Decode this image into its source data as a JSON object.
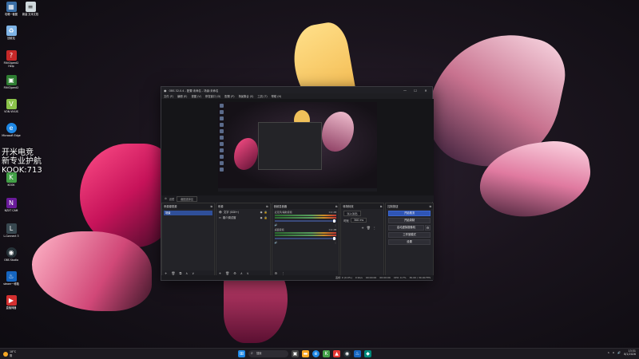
{
  "desktop": {
    "icons": [
      {
        "label": "攻略一截图",
        "icon": "image-file-icon",
        "color": "#3a6ea5"
      },
      {
        "label": "新建 文本文档",
        "icon": "text-file-icon",
        "color": "#cfd8dc"
      },
      {
        "label": "回收站",
        "icon": "recycle-bin-icon",
        "color": "#7fb4e6"
      },
      {
        "label": "FlitIO/pent2 Help",
        "icon": "help-file-icon",
        "color": "#c62828"
      },
      {
        "label": "FlitIO/pent2",
        "icon": "app-icon",
        "color": "#2e7d32"
      },
      {
        "label": "VON VIVUS",
        "icon": "v-app-icon",
        "color": "#8bc34a"
      },
      {
        "label": "Microsoft Edge",
        "icon": "edge-icon",
        "color": "#1e88e5"
      },
      {
        "label": "KOOK",
        "icon": "kook-icon",
        "color": "#43a047"
      },
      {
        "label": "NZXT CAM",
        "icon": "nzxt-cam-icon",
        "color": "#6a1b9a"
      },
      {
        "label": "L-Connect 3",
        "icon": "l-connect-icon",
        "color": "#37474f"
      },
      {
        "label": "OBS Studio",
        "icon": "obs-icon",
        "color": "#263238"
      },
      {
        "label": "steam一堆箱",
        "icon": "steam-icon",
        "color": "#1565c0"
      },
      {
        "label": "直播神器",
        "icon": "live-icon",
        "color": "#d32f2f"
      }
    ],
    "overlay_lines": [
      "开米电竞",
      "新专业护航",
      "KOOK:713"
    ]
  },
  "obs": {
    "title": "OBS 32.0.4 - 配置:未命名 - 场景:未命名",
    "window_controls": [
      "—",
      "☐",
      "✕"
    ],
    "menu": [
      "文件 (F)",
      "编辑 (E)",
      "视图 (V)",
      "停靠窗口 (D)",
      "配置 (P)",
      "场景集合 (S)",
      "工具 (T)",
      "帮助 (H)"
    ],
    "source_toolbar": {
      "gear": "⚙",
      "filter": "滤镜",
      "dropdown": "截图选择区"
    },
    "docks": {
      "scenes": {
        "title": "来源源类源",
        "items": [
          "场景"
        ]
      },
      "sources": {
        "title": "来源",
        "items": [
          {
            "name": "文字 (GDI+)"
          },
          {
            "name": "媒介调试窗"
          }
        ]
      },
      "mixer": {
        "title": "音频混音器",
        "channels": [
          {
            "name": "麦克风/辅助音频",
            "db": "0.0 dB",
            "level": 0.8
          },
          {
            "name": "桌面音频",
            "db": "0.0 dB",
            "level": 0.85
          }
        ]
      },
      "transitions": {
        "title": "转场特效",
        "type": "淡入淡出",
        "duration_label": "时长",
        "duration": "300 ms"
      },
      "controls": {
        "title": "控制按钮",
        "start_stream": "开始推流",
        "start_record": "开始录制",
        "virtual_cam": "启动虚拟摄像机",
        "studio_mode": "工作室模式",
        "settings": "设置"
      }
    },
    "dock_footer_icons": [
      "+",
      "🗑",
      "⧉",
      "∧",
      "∨"
    ],
    "status": {
      "frames": "丢帧: 0 (0.0%)",
      "bitrate": "0 kb/s",
      "rec_time": "00:00:00",
      "stream_time": "00:00:00",
      "cpu": "CPU: 0.7%",
      "fps": "30.00 / 30.00 FPS"
    }
  },
  "taskbar": {
    "weather": {
      "temp": "18°C",
      "desc": "阴"
    },
    "search_placeholder": "搜索",
    "clock": {
      "time": "13:31",
      "date": "8/1/2026"
    }
  }
}
